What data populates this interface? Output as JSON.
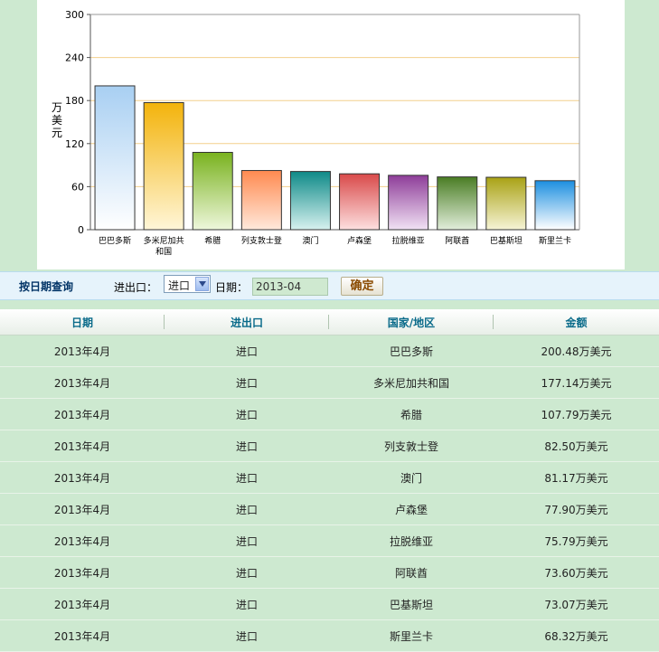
{
  "chart_data": {
    "type": "bar",
    "title": "",
    "xlabel": "",
    "ylabel": "万美元",
    "ylim": [
      0,
      300
    ],
    "yticks": [
      0,
      60,
      120,
      180,
      240,
      300
    ],
    "grid": true,
    "categories": [
      "巴巴多斯",
      "多米尼加共和国",
      "希腊",
      "列支敦士登",
      "澳门",
      "卢森堡",
      "拉脱维亚",
      "阿联酋",
      "巴基斯坦",
      "斯里兰卡"
    ],
    "category_lines": [
      [
        "巴巴多斯"
      ],
      [
        "多米尼加共",
        "和国"
      ],
      [
        "希腊"
      ],
      [
        "列支敦士登"
      ],
      [
        "澳门"
      ],
      [
        "卢森堡"
      ],
      [
        "拉脱维亚"
      ],
      [
        "阿联酋"
      ],
      [
        "巴基斯坦"
      ],
      [
        "斯里兰卡"
      ]
    ],
    "values": [
      200.48,
      177.14,
      107.79,
      82.5,
      81.17,
      77.9,
      75.79,
      73.6,
      73.07,
      68.32
    ],
    "bar_colors": [
      [
        "#a8cff2",
        "#ffffff"
      ],
      [
        "#f3b30b",
        "#fff6d8"
      ],
      [
        "#79b21e",
        "#eef7dc"
      ],
      [
        "#ff8a50",
        "#ffe9dc"
      ],
      [
        "#0e8a88",
        "#d7f1ef"
      ],
      [
        "#d94a4a",
        "#fde0e0"
      ],
      [
        "#8e3d99",
        "#f1e2f4"
      ],
      [
        "#4a7d24",
        "#e2eedb"
      ],
      [
        "#a9a215",
        "#f6f4d6"
      ],
      [
        "#1c8fe0",
        "#ffffff"
      ]
    ]
  },
  "query": {
    "title": "按日期查询",
    "io_label": "进出口：",
    "io_value": "进口",
    "date_label": "日期：",
    "date_value": "2013-04",
    "confirm_label": "确定"
  },
  "table": {
    "headers": [
      "日期",
      "进出口",
      "国家/地区",
      "金额"
    ],
    "rows": [
      [
        "2013年4月",
        "进口",
        "巴巴多斯",
        "200.48万美元"
      ],
      [
        "2013年4月",
        "进口",
        "多米尼加共和国",
        "177.14万美元"
      ],
      [
        "2013年4月",
        "进口",
        "希腊",
        "107.79万美元"
      ],
      [
        "2013年4月",
        "进口",
        "列支敦士登",
        "82.50万美元"
      ],
      [
        "2013年4月",
        "进口",
        "澳门",
        "81.17万美元"
      ],
      [
        "2013年4月",
        "进口",
        "卢森堡",
        "77.90万美元"
      ],
      [
        "2013年4月",
        "进口",
        "拉脱维亚",
        "75.79万美元"
      ],
      [
        "2013年4月",
        "进口",
        "阿联酋",
        "73.60万美元"
      ],
      [
        "2013年4月",
        "进口",
        "巴基斯坦",
        "73.07万美元"
      ],
      [
        "2013年4月",
        "进口",
        "斯里兰卡",
        "68.32万美元"
      ]
    ]
  }
}
